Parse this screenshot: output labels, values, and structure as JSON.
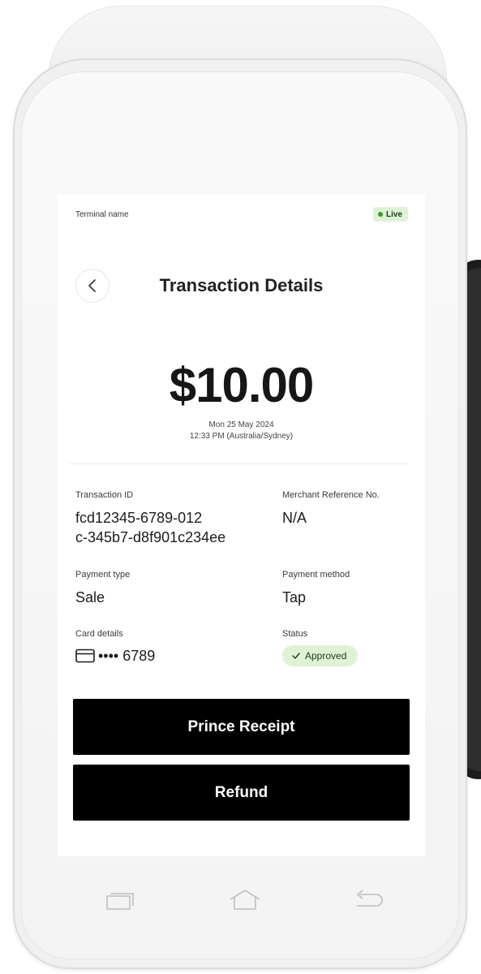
{
  "terminal": {
    "name": "Terminal name",
    "mode_badge": "Live"
  },
  "header": {
    "title": "Transaction Details"
  },
  "transaction": {
    "amount": "$10.00",
    "date": "Mon 25 May 2024",
    "time": "12:33 PM (Australia/Sydney)"
  },
  "details": {
    "transaction_id_label": "Transaction ID",
    "transaction_id_line1": "fcd12345-6789-012",
    "transaction_id_line2": "c-345b7-d8f901c234ee",
    "merchant_ref_label": "Merchant Reference No.",
    "merchant_ref_value": "N/A",
    "payment_type_label": "Payment type",
    "payment_type_value": "Sale",
    "payment_method_label": "Payment method",
    "payment_method_value": "Tap",
    "card_details_label": "Card details",
    "card_details_value": "•••• 6789",
    "status_label": "Status",
    "status_value": "Approved"
  },
  "actions": {
    "print_receipt_label": "Prince Receipt",
    "refund_label": "Refund"
  },
  "colors": {
    "badge_bg": "#def2d6",
    "badge_dot": "#3c9a2c",
    "button_bg": "#000000"
  },
  "icons": {
    "back": "chevron-left-icon",
    "card": "credit-card-icon",
    "status": "check-icon",
    "nav": [
      "recent-apps-icon",
      "home-icon",
      "back-arrow-icon"
    ]
  }
}
